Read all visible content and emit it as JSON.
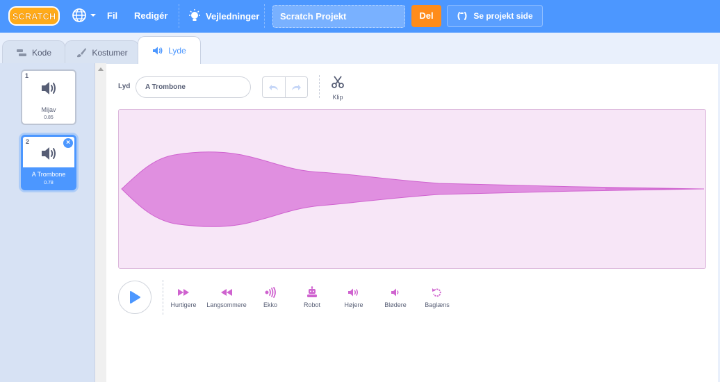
{
  "menubar": {
    "logo_text": "SCRATCH",
    "file": "Fil",
    "edit": "Redigér",
    "tutorials": "Vejledninger",
    "project_title": "Scratch Projekt",
    "share": "Del",
    "see_project": "Se projekt side"
  },
  "tabs": [
    {
      "label": "Kode"
    },
    {
      "label": "Kostumer"
    },
    {
      "label": "Lyde"
    }
  ],
  "sounds": [
    {
      "number": "1",
      "name": "Mijav",
      "duration": "0.85"
    },
    {
      "number": "2",
      "name": "A Trombone",
      "duration": "0.78"
    }
  ],
  "editor": {
    "sound_label": "Lyd",
    "sound_name": "A Trombone",
    "trim": "Klip",
    "effects": [
      {
        "label": "Hurtigere",
        "icon": "faster-icon"
      },
      {
        "label": "Langsommere",
        "icon": "slower-icon"
      },
      {
        "label": "Ekko",
        "icon": "echo-icon"
      },
      {
        "label": "Robot",
        "icon": "robot-icon"
      },
      {
        "label": "Højere",
        "icon": "louder-icon"
      },
      {
        "label": "Blødere",
        "icon": "softer-icon"
      },
      {
        "label": "Baglæns",
        "icon": "reverse-icon"
      }
    ]
  },
  "colors": {
    "menubar": "#4c97ff",
    "share": "#ff8c1a",
    "waveform": "#cf63cf",
    "effects": "#cf63cf"
  }
}
